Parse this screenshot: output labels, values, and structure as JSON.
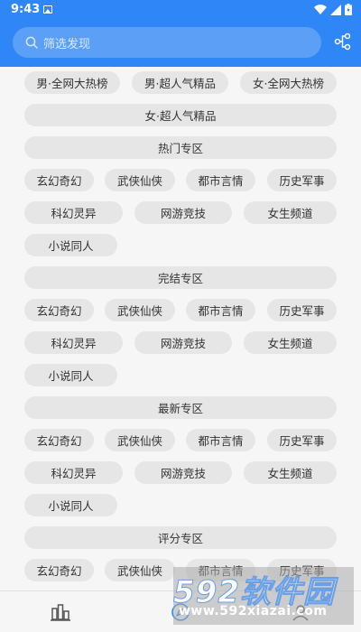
{
  "status_bar": {
    "time": "9:43"
  },
  "search": {
    "placeholder": "筛选发现"
  },
  "top_tags": [
    "男·全网大热榜",
    "男·超人气精品",
    "女·全网大热榜",
    "女·超人气精品"
  ],
  "sections": [
    {
      "title": "热门专区",
      "tags": [
        "玄幻奇幻",
        "武侠仙侠",
        "都市言情",
        "历史军事",
        "科幻灵异",
        "网游竞技",
        "女生频道",
        "小说同人"
      ]
    },
    {
      "title": "完结专区",
      "tags": [
        "玄幻奇幻",
        "武侠仙侠",
        "都市言情",
        "历史军事",
        "科幻灵异",
        "网游竞技",
        "女生频道",
        "小说同人"
      ]
    },
    {
      "title": "最新专区",
      "tags": [
        "玄幻奇幻",
        "武侠仙侠",
        "都市言情",
        "历史军事",
        "科幻灵异",
        "网游竞技",
        "女生频道",
        "小说同人"
      ]
    },
    {
      "title": "评分专区",
      "tags": [
        "玄幻奇幻",
        "武侠仙侠",
        "都市言情",
        "历史军事"
      ]
    }
  ],
  "watermark": {
    "brand": "592软件园",
    "url": "www.592xiazai.com"
  },
  "icons": {
    "search": "search-icon",
    "filter": "filter-icon",
    "bookshelf": "bookshelf-icon",
    "discover": "discover-icon",
    "profile": "profile-icon"
  },
  "colors": {
    "primary": "#2f86f6",
    "chip_bg": "#e6e6e6",
    "page_bg": "#f6f6f6"
  }
}
